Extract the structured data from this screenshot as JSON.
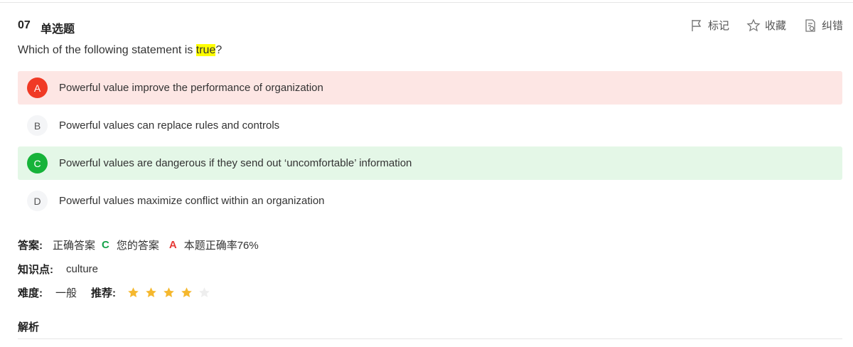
{
  "question": {
    "number": "07",
    "type": "单选题",
    "text_before": "Which of the following statement is ",
    "text_highlight": "true",
    "text_after": "?"
  },
  "actions": {
    "mark_label": "标记",
    "favorite_label": "收藏",
    "report_label": "纠错"
  },
  "options": [
    {
      "letter": "A",
      "text": "Powerful value improve the performance of organization",
      "state": "wrong"
    },
    {
      "letter": "B",
      "text": "Powerful values can replace rules and controls",
      "state": "normal"
    },
    {
      "letter": "C",
      "text": "Powerful values are dangerous if they send out ‘uncomfortable’ information",
      "state": "correct"
    },
    {
      "letter": "D",
      "text": "Powerful values maximize conflict within an organization",
      "state": "normal"
    }
  ],
  "answer": {
    "label": "答案:",
    "correct_label": "正确答案",
    "correct_value": "C",
    "yours_label": "您的答案",
    "yours_value": "A",
    "rate_text": "本题正确率76%"
  },
  "knowledge": {
    "label": "知识点:",
    "value": "culture"
  },
  "difficulty": {
    "label": "难度:",
    "value": "一般",
    "recommend_label": "推荐:",
    "stars_filled": 4,
    "stars_total": 5
  },
  "analysis": {
    "label": "解析"
  },
  "colors": {
    "wrong_bg": "#fde6e4",
    "correct_bg": "#e4f7e7",
    "wrong_badge": "#f03a25",
    "correct_badge": "#16b339",
    "star_filled": "#f5b82e",
    "star_empty": "#eeeeee",
    "highlight": "#ffff00"
  }
}
